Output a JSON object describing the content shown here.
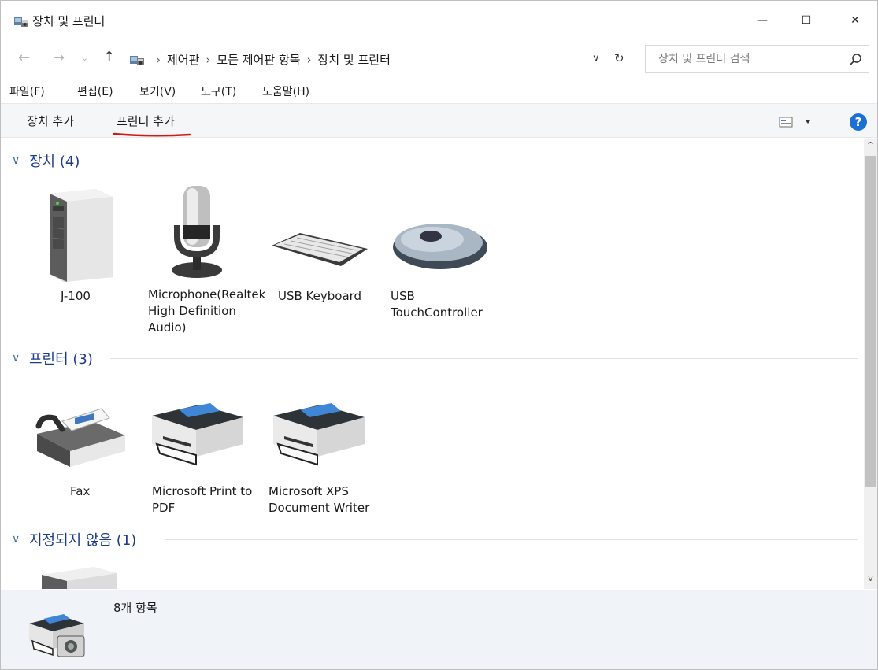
{
  "window": {
    "title": "장치 및 프린터",
    "controls": {
      "minimize": "—",
      "maximize": "☐",
      "close": "✕"
    }
  },
  "address": {
    "breadcrumbs": [
      "제어판",
      "모든 제어판 항목",
      "장치 및 프린터"
    ],
    "search_placeholder": "장치 및 프린터 검색"
  },
  "menu": [
    "파일(F)",
    "편집(E)",
    "보기(V)",
    "도구(T)",
    "도움말(H)"
  ],
  "commands": {
    "add_device": "장치 추가",
    "add_printer": "프린터 추가"
  },
  "help_label": "?",
  "groups": {
    "devices": {
      "title": "장치 (4)",
      "items": [
        {
          "label": "J-100",
          "icon": "tower-computer-icon"
        },
        {
          "label": "Microphone(Realtek High Definition Audio)",
          "icon": "microphone-icon"
        },
        {
          "label": "USB Keyboard",
          "icon": "keyboard-icon"
        },
        {
          "label": "USB TouchController",
          "icon": "mouse-icon"
        }
      ]
    },
    "printers": {
      "title": "프린터 (3)",
      "items": [
        {
          "label": "Fax",
          "icon": "fax-icon"
        },
        {
          "label": "Microsoft Print to PDF",
          "icon": "printer-icon"
        },
        {
          "label": "Microsoft XPS Document Writer",
          "icon": "printer-icon"
        }
      ]
    },
    "unspecified": {
      "title": "지정되지 않음 (1)"
    }
  },
  "details": {
    "count": "8개 항목"
  },
  "colors": {
    "accent": "#1e3b8a",
    "underline": "#d01a1a",
    "help": "#1c6fd3"
  }
}
